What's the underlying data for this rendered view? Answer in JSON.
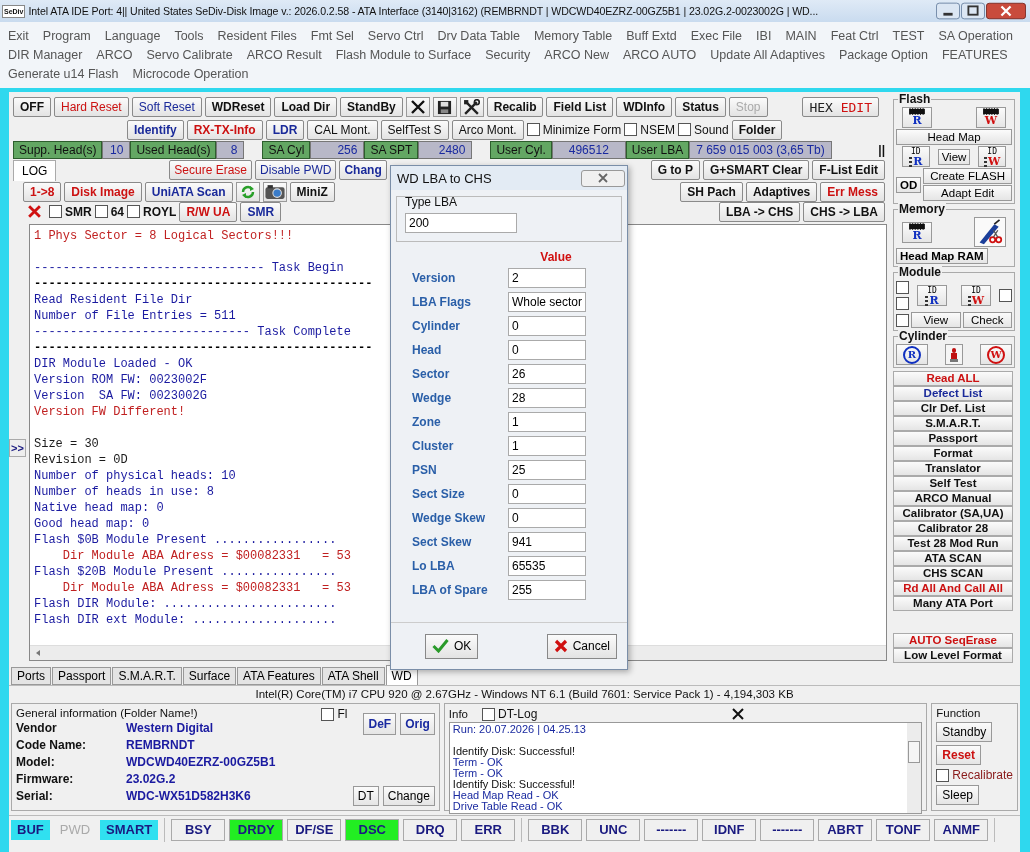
{
  "window": {
    "app_icon": "SeDiv",
    "title": "Intel ATA IDE  Port: 4|| United States  SeDiv-Disk Image v.: 2026.0.2.58 - ATA Interface (3140|3162)  (REMBRNDT | WDCWD40EZRZ-00GZ5B1 | 23.02G.2-0023002G | WD..."
  },
  "menu": [
    [
      "Exit",
      "Program",
      "Language",
      "Tools",
      "Resident Files",
      "Fmt Sel",
      "Servo Ctrl",
      "Drv Data Table",
      "Memory Table",
      "Buff Extd",
      "Exec File",
      "IBI",
      "MAIN",
      "Feat Ctrl",
      "TEST",
      "SA Operation"
    ],
    [
      "DIR Manager",
      "ARCO",
      "Servo Calibrate",
      "ARCO Result",
      "Flash Module to Surface",
      "Security",
      "ARCO New",
      "ARCO AUTO",
      "Update All Adaptives",
      "Package Option",
      "FEATURES"
    ],
    [
      "Generate u14 Flash",
      "Microcode Operation"
    ]
  ],
  "toolbar_rows": [
    {
      "left": [
        {
          "kind": "strong",
          "label": "OFF"
        },
        {
          "kind": "normal",
          "label": "Hard Reset",
          "color": "#cc1111"
        },
        {
          "kind": "normal",
          "label": "Soft Reset",
          "color": "#1a2a9a"
        },
        {
          "kind": "strong",
          "label": "WDReset"
        },
        {
          "kind": "strong",
          "label": "Load Dir"
        },
        {
          "kind": "strong",
          "label": "StandBy"
        },
        {
          "kind": "close"
        },
        {
          "kind": "save"
        },
        {
          "kind": "tools"
        },
        {
          "kind": "strong",
          "label": "Recalib"
        },
        {
          "kind": "strong",
          "label": "Field List"
        },
        {
          "kind": "strong",
          "label": "WDInfo"
        },
        {
          "kind": "strong",
          "label": "Status"
        },
        {
          "kind": "normal",
          "label": "Stop",
          "disabled": true
        }
      ],
      "right": [
        {
          "kind": "hex",
          "label": "HEX",
          "label2": "EDIT"
        }
      ]
    },
    {
      "left": [
        {
          "kind": "strong",
          "label": "Identify",
          "color": "#1a2a9a"
        },
        {
          "kind": "strong",
          "label": "RX-TX-Info",
          "color": "#cc1111"
        },
        {
          "kind": "strong",
          "label": "LDR",
          "color": "#1a2a9a"
        },
        {
          "kind": "normal",
          "label": "CAL Mont."
        },
        {
          "kind": "normal",
          "label": "SelfTest S"
        },
        {
          "kind": "normal",
          "label": "Arco Mont."
        },
        {
          "kind": "checkbox",
          "label": "Minimize Form",
          "checked": false
        },
        {
          "kind": "checkbox",
          "label": "NSEM",
          "checked": false
        },
        {
          "kind": "checkbox",
          "label": "Sound",
          "checked": false
        },
        {
          "kind": "strong",
          "label": "Folder"
        }
      ],
      "right": []
    },
    {
      "left": [
        {
          "kind": "tab",
          "label": "LOG",
          "selected": true
        },
        {
          "kind": "normal",
          "label": "Secure Erase",
          "color": "#cc1111"
        },
        {
          "kind": "normal",
          "label": "Disable PWD",
          "color": "#1a2a9a"
        },
        {
          "kind": "strong",
          "label": "Chang",
          "color": "#1a2a9a"
        }
      ],
      "right": [
        {
          "kind": "strong",
          "label": "G to P"
        },
        {
          "kind": "strong",
          "label": "G+SMART Clear"
        },
        {
          "kind": "strong",
          "label": "F-List Edit"
        }
      ]
    },
    {
      "left": [
        {
          "kind": "strong",
          "label": "1->8",
          "color": "#cc1111"
        },
        {
          "kind": "strong",
          "label": "Disk Image",
          "color": "#cc1111"
        },
        {
          "kind": "strong",
          "label": "UniATA Scan",
          "color": "#1a2a9a"
        },
        {
          "kind": "refresh"
        },
        {
          "kind": "camera"
        },
        {
          "kind": "strong",
          "label": "MiniZ"
        }
      ],
      "right": [
        {
          "kind": "strong",
          "label": "SH Pach"
        },
        {
          "kind": "strong",
          "label": "Adaptives"
        },
        {
          "kind": "strong",
          "label": "Err Mess",
          "color": "#cc1111"
        }
      ]
    },
    {
      "left": [
        {
          "kind": "delete"
        },
        {
          "kind": "checkbox",
          "label": "SMR",
          "checked": false
        },
        {
          "kind": "checkbox",
          "label": "64",
          "checked": false
        },
        {
          "kind": "checkbox",
          "label": "ROYL",
          "checked": false
        },
        {
          "kind": "strong",
          "label": "R/W UA",
          "color": "#cc1111"
        },
        {
          "kind": "strong",
          "label": "SMR",
          "color": "#1a2a9a"
        }
      ],
      "right": [
        {
          "kind": "strong",
          "label": "LBA -> CHS"
        },
        {
          "kind": "strong",
          "label": "CHS -> LBA"
        }
      ]
    }
  ],
  "info_groups": [
    [
      {
        "label": "Supp. Head(s)",
        "value": "10"
      },
      {
        "label": "Used Head(s)",
        "value": "8"
      }
    ],
    [
      {
        "label": "SA Cyl",
        "value": "256"
      },
      {
        "label": "SA SPT",
        "value": "2480"
      }
    ],
    [
      {
        "label": "User Cyl.",
        "value": "496512"
      },
      {
        "label": "User LBA",
        "value": "7 659 015 003  (3,65 Tb)"
      }
    ]
  ],
  "info_tail": "||",
  "expand_button": ">>",
  "log": [
    {
      "kind": "text",
      "text": "1 Phys Sector = 8 Logical Sectors!!!",
      "color": "#c02020"
    },
    {
      "kind": "blank"
    },
    {
      "kind": "text",
      "text": "-------------------------------- Task Begin",
      "color": "#1a1aa0"
    },
    {
      "kind": "rule",
      "text": "-----------------------------------------------",
      "color": "#000000"
    },
    {
      "kind": "text",
      "text": "Read Resident File Dir",
      "color": "#1a1aa0"
    },
    {
      "kind": "text",
      "text": "Number of File Entries = 511",
      "color": "#1a1aa0"
    },
    {
      "kind": "text",
      "text": "------------------------------ Task Complete",
      "color": "#1a1aa0"
    },
    {
      "kind": "rule",
      "text": "-----------------------------------------------",
      "color": "#000000"
    },
    {
      "kind": "text",
      "text": "DIR Module Loaded - OK",
      "color": "#1a1aa0"
    },
    {
      "kind": "text",
      "text": "Version ROM FW: 0023002F",
      "color": "#1a1aa0"
    },
    {
      "kind": "text",
      "text": "Version  SA FW: 0023002G",
      "color": "#1a1aa0"
    },
    {
      "kind": "text",
      "text": "Version FW Different!",
      "color": "#c02020"
    },
    {
      "kind": "blank"
    },
    {
      "kind": "text",
      "text": "Size = 30",
      "color": "#1a1a1a"
    },
    {
      "kind": "text",
      "text": "Revision = 0D",
      "color": "#1a1a1a"
    },
    {
      "kind": "text",
      "text": "Number of physical heads: 10",
      "color": "#1a1aa0"
    },
    {
      "kind": "text",
      "text": "Number of heads in use: 8",
      "color": "#1a1aa0"
    },
    {
      "kind": "text",
      "text": "Native head map: 0",
      "color": "#1a1aa0"
    },
    {
      "kind": "text",
      "text": "Good head map: 0",
      "color": "#1a1aa0"
    },
    {
      "kind": "text",
      "text": "Flash $0B Module Present .................",
      "color": "#1a1aa0"
    },
    {
      "kind": "text",
      "text": "    Dir Module ABA Adress = $00082331   = 53",
      "color": "#c02020"
    },
    {
      "kind": "text",
      "text": "Flash $20B Module Present ................",
      "color": "#1a1aa0"
    },
    {
      "kind": "text",
      "text": "    Dir Module ABA Adress = $00082331   = 53",
      "color": "#c02020"
    },
    {
      "kind": "text",
      "text": "Flash DIR Module: ........................",
      "color": "#1a1aa0"
    },
    {
      "kind": "text",
      "text": "Flash DIR ext Module: ....................",
      "color": "#1a1aa0"
    }
  ],
  "side_sections": [
    {
      "title": "Flash",
      "rows": [
        {
          "items": [
            {
              "kind": "chip",
              "letter": "R",
              "color": "#1030c0"
            },
            {
              "kind": "chip",
              "letter": "W",
              "color": "#d01010"
            }
          ]
        },
        {
          "items": [
            {
              "kind": "button",
              "label": "Head Map"
            }
          ]
        },
        {
          "items": [
            {
              "kind": "id",
              "tag": "ID",
              "letter": "R",
              "color": "#1030c0"
            },
            {
              "kind": "button",
              "label": "View"
            },
            {
              "kind": "id",
              "tag": "ID",
              "letter": "W",
              "color": "#d01010"
            }
          ]
        },
        {
          "items": [
            {
              "kind": "big",
              "label": "OD"
            },
            {
              "kind": "stack",
              "items": [
                {
                  "kind": "button",
                  "label": "Create FLASH"
                },
                {
                  "kind": "button",
                  "label": "Adapt Edit"
                }
              ]
            }
          ]
        }
      ]
    },
    {
      "title": "Memory",
      "rows": [
        {
          "items": [
            {
              "kind": "chip",
              "letter": "R",
              "color": "#1030c0"
            },
            {
              "kind": "tool"
            }
          ]
        },
        {
          "items": [
            {
              "kind": "big",
              "label": "Head Map RAM"
            }
          ]
        }
      ]
    },
    {
      "title": "Module",
      "rows": [
        {
          "items": [
            {
              "kind": "stack",
              "items": [
                {
                  "kind": "checkbox",
                  "checked": false
                },
                {
                  "kind": "checkbox",
                  "checked": false
                }
              ]
            },
            {
              "kind": "id",
              "tag": "ID",
              "letter": "R",
              "color": "#1030c0"
            },
            {
              "kind": "id",
              "tag": "ID",
              "letter": "W",
              "color": "#d01010"
            },
            {
              "kind": "checkbox",
              "checked": false
            }
          ]
        },
        {
          "items": [
            {
              "kind": "checkbox",
              "checked": false
            },
            {
              "kind": "button",
              "label": "View"
            },
            {
              "kind": "button",
              "label": "Check"
            }
          ]
        }
      ]
    },
    {
      "title": "Cylinder",
      "rows": [
        {
          "items": [
            {
              "kind": "circle",
              "letter": "R",
              "color": "#1030c0"
            },
            {
              "kind": "lamp"
            },
            {
              "kind": "circle",
              "letter": "W",
              "color": "#d01010"
            }
          ]
        }
      ]
    }
  ],
  "side_buttons": [
    {
      "label": "Read ALL",
      "color": "#cc1111"
    },
    {
      "label": "Defect List",
      "color": "#1a2a9a"
    },
    {
      "label": "Clr Def. List"
    },
    {
      "label": "S.M.A.R.T."
    },
    {
      "label": "Passport"
    },
    {
      "label": "Format"
    },
    {
      "label": "Translator"
    },
    {
      "label": "Self Test"
    },
    {
      "label": "ARCO Manual"
    },
    {
      "label": "Calibrator (SA,UA)"
    },
    {
      "label": "Calibrator 28"
    },
    {
      "label": "Test 28 Mod Run"
    },
    {
      "label": "ATA SCAN"
    },
    {
      "label": "CHS SCAN"
    },
    {
      "label": "Rd All And Call All",
      "color": "#cc1111"
    },
    {
      "label": "Many ATA Port"
    }
  ],
  "side_bottom_buttons": [
    {
      "label": "AUTO SeqErase",
      "color": "#cc1111"
    },
    {
      "label": "Low Level Format"
    }
  ],
  "dialog": {
    "title": "WD LBA to CHS",
    "group": "Type LBA",
    "lba": "200",
    "value_header": "Value",
    "fields": [
      {
        "label": "Version",
        "value": "2"
      },
      {
        "label": "LBA Flags",
        "value": "Whole sector"
      },
      {
        "label": "Cylinder",
        "value": "0"
      },
      {
        "label": "Head",
        "value": "0"
      },
      {
        "label": "Sector",
        "value": "26"
      },
      {
        "label": "Wedge",
        "value": "28"
      },
      {
        "label": "Zone",
        "value": "1"
      },
      {
        "label": "Cluster",
        "value": "1"
      },
      {
        "label": "PSN",
        "value": "25"
      },
      {
        "label": "Sect Size",
        "value": "0"
      },
      {
        "label": "Wedge Skew",
        "value": "0"
      },
      {
        "label": "Sect Skew",
        "value": "941"
      },
      {
        "label": "Lo LBA",
        "value": "65535"
      },
      {
        "label": "LBA of Spare",
        "value": "255"
      }
    ],
    "ok": "OK",
    "cancel": "Cancel"
  },
  "bottom_tabs": [
    {
      "label": "Ports",
      "selected": false
    },
    {
      "label": "Passport",
      "selected": false
    },
    {
      "label": "S.M.A.R.T.",
      "selected": false
    },
    {
      "label": "Surface",
      "selected": false
    },
    {
      "label": "ATA Features",
      "selected": false
    },
    {
      "label": "ATA Shell",
      "selected": false
    },
    {
      "label": "WD",
      "selected": true
    }
  ],
  "system_line": "Intel(R) Core(TM) i7 CPU 920  @ 2.67GHz - Windows NT 6.1 (Build 7601: Service Pack 1) -  4,194,303 KB",
  "general": {
    "title": "General information (Folder Name!)",
    "checkbox": {
      "label": "Fl",
      "checked": false
    },
    "buttons": [
      "DeF",
      "Orig"
    ],
    "fields": [
      {
        "label": "Vendor",
        "value": "Western Digital"
      },
      {
        "label": "Code Name:",
        "value": "REMBRNDT"
      },
      {
        "label": "Model:",
        "value": "WDCWD40EZRZ-00GZ5B1"
      },
      {
        "label": "Firmware:",
        "value": "23.02G.2"
      },
      {
        "label": "Serial:",
        "value": "WDC-WX51D582H3K6"
      }
    ],
    "bottom_buttons": [
      "DT",
      "Change"
    ]
  },
  "info": {
    "title": "Info",
    "checkbox": {
      "label": "DT-Log",
      "checked": false
    },
    "lines": [
      {
        "kind": "text",
        "text": "Run: 20.07.2026 | 04.25.13",
        "color": "#1a2aa0"
      },
      {
        "kind": "blank"
      },
      {
        "kind": "text",
        "text": "Identify Disk: Successful!",
        "color": "#111111"
      },
      {
        "kind": "text",
        "text": "Term - OK",
        "color": "#1a2aa0"
      },
      {
        "kind": "text",
        "text": "Term - OK",
        "color": "#1a2aa0"
      },
      {
        "kind": "text",
        "text": "Identify Disk: Successful!",
        "color": "#111111"
      },
      {
        "kind": "text",
        "text": "Head Map Read - OK",
        "color": "#1a2aa0"
      },
      {
        "kind": "text",
        "text": "Drive Table Read - OK",
        "color": "#1a2aa0"
      }
    ]
  },
  "function": {
    "title": "Function",
    "items": [
      {
        "kind": "button",
        "label": "Standby"
      },
      {
        "kind": "button",
        "label": "Reset",
        "color": "#cc1111"
      },
      {
        "kind": "checkbox",
        "label": "Recalibrate",
        "checked": false
      },
      {
        "kind": "button",
        "label": "Sleep"
      }
    ]
  },
  "status": {
    "left": [
      {
        "label": "BUF",
        "lit": true,
        "disabled": false
      },
      {
        "label": "PWD",
        "lit": false,
        "disabled": true
      },
      {
        "label": "SMART",
        "lit": true,
        "disabled": false
      }
    ],
    "middle": [
      {
        "label": "BSY",
        "lit": false
      },
      {
        "label": "DRDY",
        "lit": true
      },
      {
        "label": "DF/SE",
        "lit": false
      },
      {
        "label": "DSC",
        "lit": true
      },
      {
        "label": "DRQ",
        "lit": false
      },
      {
        "label": "ERR",
        "lit": false
      }
    ],
    "right": [
      {
        "label": "BBK",
        "lit": false
      },
      {
        "label": "UNC",
        "lit": false
      },
      {
        "label": "-------",
        "lit": false
      },
      {
        "label": "IDNF",
        "lit": false
      },
      {
        "label": "-------",
        "lit": false
      },
      {
        "label": "ABRT",
        "lit": false
      },
      {
        "label": "TONF",
        "lit": false
      },
      {
        "label": "ANMF",
        "lit": false
      }
    ]
  }
}
